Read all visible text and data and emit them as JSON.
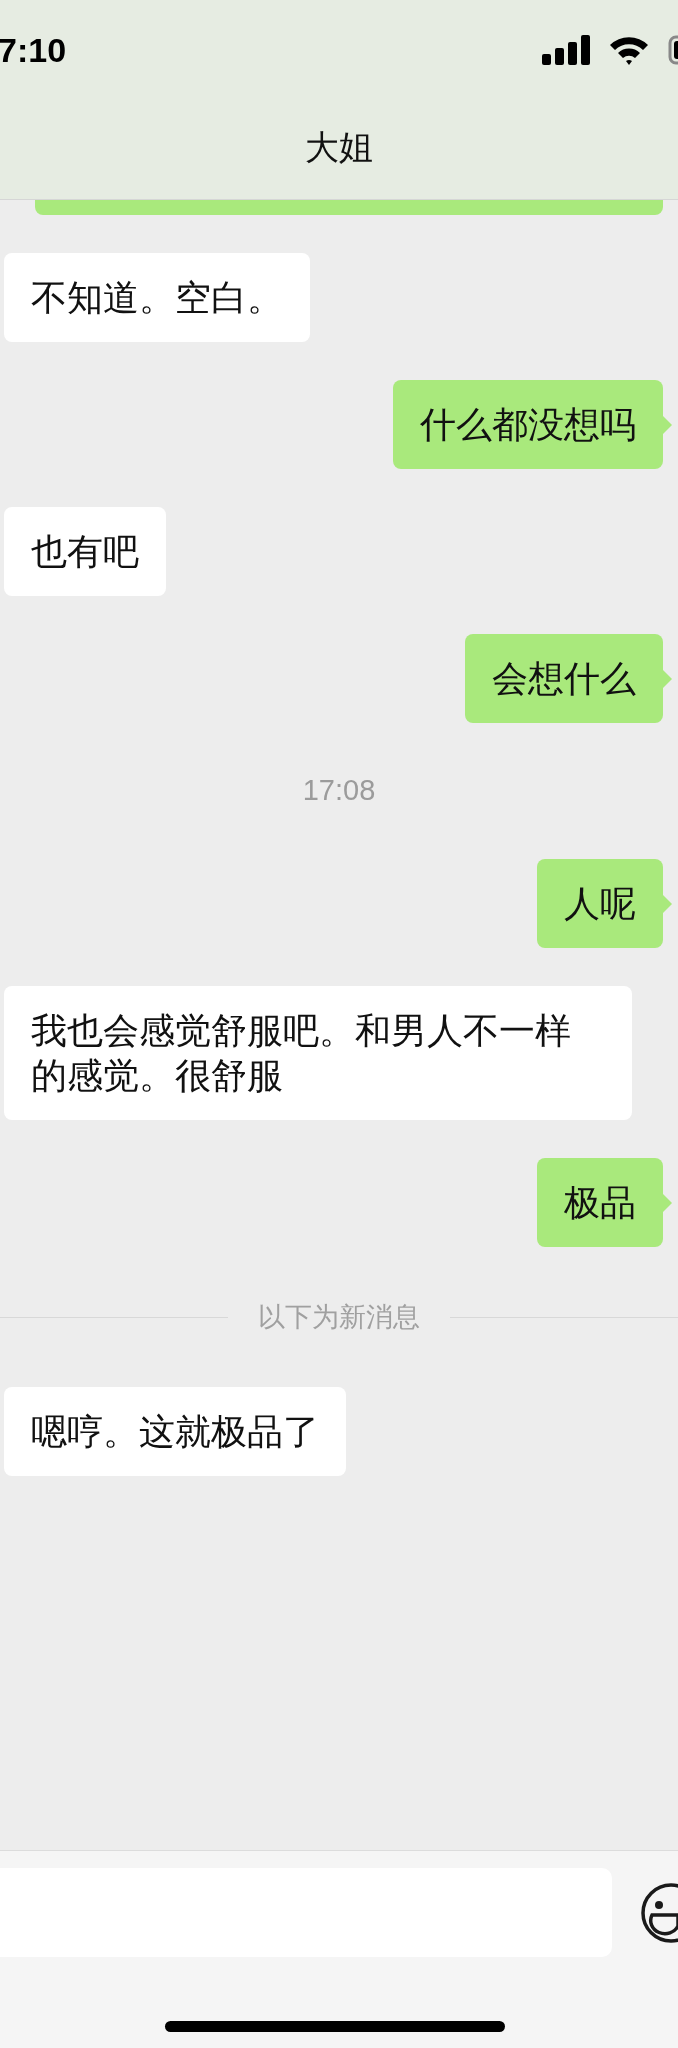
{
  "status_bar": {
    "time": "7:10"
  },
  "header": {
    "title": "大姐"
  },
  "messages": [
    {
      "kind": "clipped",
      "outgoing": true
    },
    {
      "kind": "bubble",
      "outgoing": false,
      "text": "不知道。空白。"
    },
    {
      "kind": "bubble",
      "outgoing": true,
      "text": "什么都没想吗"
    },
    {
      "kind": "bubble",
      "outgoing": false,
      "text": "也有吧"
    },
    {
      "kind": "bubble",
      "outgoing": true,
      "text": "会想什么"
    },
    {
      "kind": "time",
      "text": "17:08"
    },
    {
      "kind": "bubble",
      "outgoing": true,
      "text": "人呢"
    },
    {
      "kind": "bubble",
      "outgoing": false,
      "text": "我也会感觉舒服吧。和男人不一样的感觉。很舒服"
    },
    {
      "kind": "bubble",
      "outgoing": true,
      "text": "极品"
    },
    {
      "kind": "divider",
      "text": "以下为新消息"
    },
    {
      "kind": "bubble",
      "outgoing": false,
      "text": "嗯哼。这就极品了"
    }
  ]
}
